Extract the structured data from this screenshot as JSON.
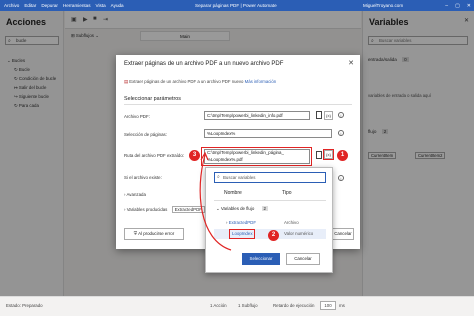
{
  "titlebar": {
    "menu": [
      "Archivo",
      "Editar",
      "Depurar",
      "Herramientas",
      "Vista",
      "Ayuda"
    ],
    "title": "Separar páginas PDF | Power Automate",
    "user": "MiguelTroyano.com",
    "controls": [
      "–",
      "▢",
      "✕"
    ]
  },
  "left": {
    "title": "Acciones",
    "search_value": "bucle",
    "items": [
      "Bucles",
      "Bucle",
      "Condición de bucle",
      "Salir del bucle",
      "Siguiente bucle",
      "Para cada"
    ]
  },
  "toolbar": {
    "subflows": "Subflujos",
    "main_tab": "Main"
  },
  "right": {
    "title": "Variables",
    "search_placeholder": "Buscar variables",
    "io_section": "entrada/salida",
    "io_count": "0",
    "io_hint": "variables de entrada o salida aquí",
    "flow_section": "flujo",
    "flow_count": "2",
    "chip1": "CurrentItem",
    "chip2": "CurrentItem2"
  },
  "status": {
    "state_label": "Estado: Preparado",
    "actions_count": "1 Acción",
    "subflows_count": "1 Subflujo",
    "delay_label": "Retardo de ejecución",
    "delay_value": "100",
    "delay_unit": "ms"
  },
  "dialog": {
    "title": "Extraer páginas de un archivo PDF a un nuevo archivo PDF",
    "close": "✕",
    "description": "Extraer páginas de un archivo PDF a un archivo PDF nuevo",
    "more_info": "Más información",
    "section": "Seleccionar parámetros",
    "fields": {
      "pdf_file_label": "Archivo PDF:",
      "pdf_file_value": "C:\\tmp\\Temp\\powerbi_linkedin_info.pdf",
      "pages_label": "Selección de páginas:",
      "pages_value": "%LoopIndex%",
      "extracted_label": "Ruta del archivo PDF extraído:",
      "extracted_value_line1": "C:\\tmp\\Temp\\powerbi_linkedin_página_",
      "extracted_value_line2": "%LoopIndex%.pdf",
      "exists_label": "Si el archivo existe:"
    },
    "fx": "{x}",
    "advanced": "Avanzada",
    "produced_vars": "Variables producidas",
    "produced_var_chip": "ExtractedPDF",
    "on_error": "Al producirse error",
    "save": "Guardar",
    "cancel": "Cancelar"
  },
  "dropdown": {
    "search_placeholder": "Buscar variables",
    "col_name": "Nombre",
    "col_type": "Tipo",
    "group_label": "Variables de flujo",
    "group_count": "2",
    "rows": [
      {
        "name": "ExtractedPDF",
        "type": "Archivo"
      },
      {
        "name": "LoopIndex",
        "type": "Valor numérico"
      }
    ],
    "select": "Seleccionar",
    "cancel": "Cancelar"
  },
  "callouts": [
    "1",
    "2",
    "3"
  ],
  "colors": {
    "brand": "#2b5eb5",
    "callout": "#e02424"
  }
}
